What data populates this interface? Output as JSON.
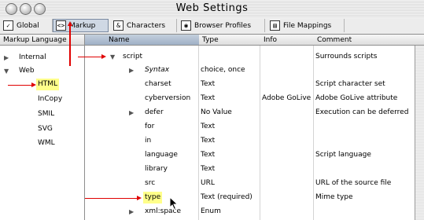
{
  "window": {
    "title": "Web Settings"
  },
  "tabs": [
    {
      "label": "Global",
      "icon": "global-icon",
      "glyph": "✓"
    },
    {
      "label": "Markup",
      "icon": "markup-icon",
      "glyph": "<>"
    },
    {
      "label": "Characters",
      "icon": "characters-icon",
      "glyph": "&"
    },
    {
      "label": "Browser Profiles",
      "icon": "browser-profiles-icon",
      "glyph": "◉"
    },
    {
      "label": "File Mappings",
      "icon": "file-mappings-icon",
      "glyph": "▤"
    }
  ],
  "left_panel": {
    "header": "Markup Language",
    "items": [
      {
        "label": "Internal"
      },
      {
        "label": "Web"
      },
      {
        "label": "HTML",
        "highlighted": true
      },
      {
        "label": "InCopy"
      },
      {
        "label": "SMIL"
      },
      {
        "label": "SVG"
      },
      {
        "label": "WML"
      }
    ]
  },
  "table": {
    "columns": [
      "Name",
      "Type",
      "Info",
      "Comment"
    ],
    "rows": [
      {
        "name": "script",
        "type": "",
        "info": "",
        "comment": "Surrounds scripts"
      },
      {
        "name": "Syntax",
        "type": "choice, once",
        "info": "",
        "comment": ""
      },
      {
        "name": "charset",
        "type": "Text",
        "info": "",
        "comment": "Script character set"
      },
      {
        "name": "cyberversion",
        "type": "Text",
        "info": "Adobe GoLive",
        "comment": "Adobe GoLive attribute"
      },
      {
        "name": "defer",
        "type": "No Value",
        "info": "",
        "comment": "Execution can be deferred"
      },
      {
        "name": "for",
        "type": "Text",
        "info": "",
        "comment": ""
      },
      {
        "name": "in",
        "type": "Text",
        "info": "",
        "comment": ""
      },
      {
        "name": "language",
        "type": "Text",
        "info": "",
        "comment": "Script language"
      },
      {
        "name": "library",
        "type": "Text",
        "info": "",
        "comment": ""
      },
      {
        "name": "src",
        "type": "URL",
        "info": "",
        "comment": "URL of the source file"
      },
      {
        "name": "type",
        "type": "Text (required)",
        "info": "",
        "comment": "Mime type"
      },
      {
        "name": "xml:space",
        "type": "Enum",
        "info": "",
        "comment": ""
      }
    ]
  },
  "colors": {
    "annotation_arrow": "#e00000",
    "highlight": "#ffff8a"
  }
}
